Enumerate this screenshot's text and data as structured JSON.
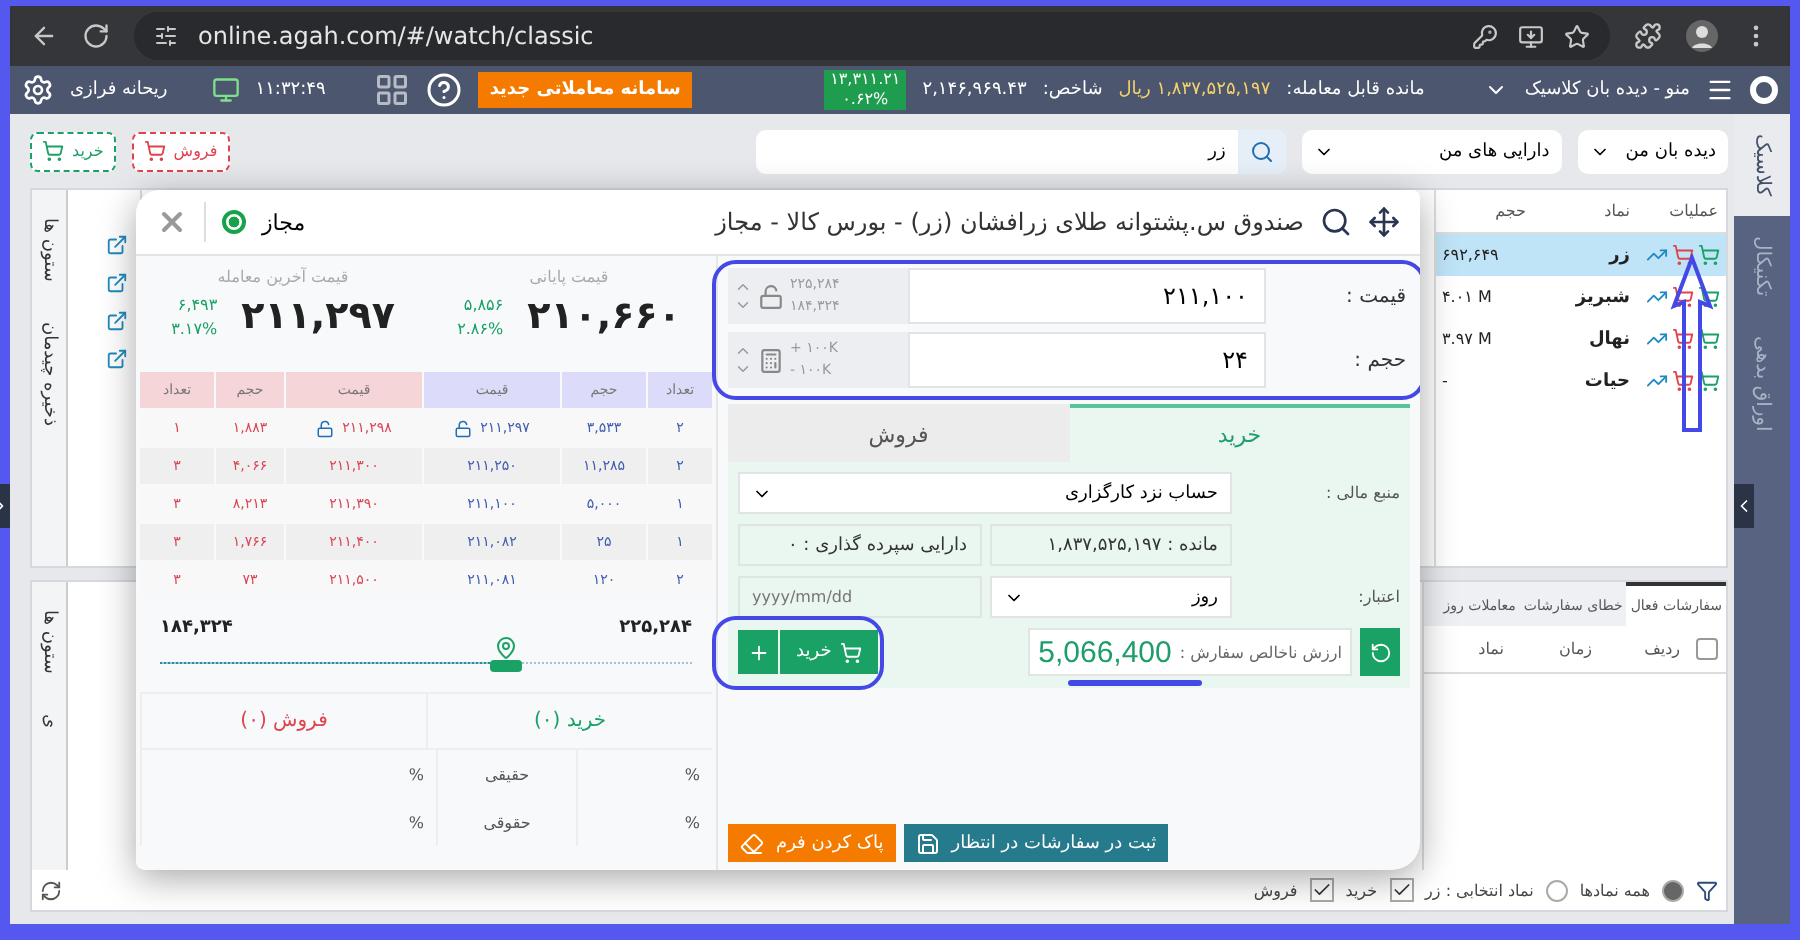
{
  "browser": {
    "url": "online.agah.com/#/watch/classic"
  },
  "header": {
    "menu": "منو - دیده بان کلاسیک",
    "balance_label": "مانده قابل معامله:",
    "balance": "۱,۸۳۷,۵۲۵,۱۹۷ ریال",
    "index_label": "شاخص:",
    "index": "۲,۱۴۶,۹۶۹.۴۳",
    "index_change": "۱۳,۳۱۱.۲۱",
    "index_percent": "۰.۶۲%",
    "new_system": "سامانه معاملاتی جدید",
    "time": "۱۱:۳۲:۴۹",
    "user": "ریحانه فرازی"
  },
  "toolbar": {
    "watchlist": "دیده بان من",
    "assets": "دارایی های من",
    "search": "زر",
    "sell": "فروش",
    "buy": "خرید"
  },
  "side_tabs": [
    {
      "label": "کلاسیک",
      "selected": true
    },
    {
      "label": "تکنیکال",
      "selected": false
    },
    {
      "label": "اوراق بدهی",
      "selected": false
    }
  ],
  "left_panel": {
    "top_labels": [
      "ستون ها",
      "ذخیره چیدمان"
    ],
    "bottom_labels": [
      "ستون ها",
      "ی"
    ]
  },
  "watchlist": {
    "columns": [
      "عملیات",
      "نماد",
      "حجم"
    ],
    "rows": [
      {
        "symbol": "زر",
        "volume": "۶۹۲,۶۴۹",
        "selected": true
      },
      {
        "symbol": "شبریز",
        "volume": "۴.۰۱ M",
        "selected": false
      },
      {
        "symbol": "نهال",
        "volume": "۳.۹۷ M",
        "selected": false
      },
      {
        "symbol": "حیات",
        "volume": "-",
        "selected": false
      }
    ]
  },
  "orders": {
    "tabs": [
      {
        "label": "سفارشات فعال",
        "selected": true
      },
      {
        "label": "خطای سفارشات",
        "selected": false
      },
      {
        "label": "معاملات روز",
        "selected": false
      }
    ],
    "select_all": {
      "checked": false
    },
    "columns": [
      "ردیف",
      "زمان",
      "نماد"
    ],
    "filters": [
      {
        "kind": "radio",
        "label": "همه نمادها",
        "checked": true
      },
      {
        "kind": "radio",
        "label": "نماد انتخابی : زر",
        "checked": false
      },
      {
        "kind": "checkbox",
        "label": "خرید",
        "checked": true
      },
      {
        "kind": "checkbox",
        "label": "فروش",
        "checked": true
      }
    ]
  },
  "dialog": {
    "title": "صندوق س.پشتوانه طلای زرافشان (زر) - بورس کالا - مجاز",
    "status": {
      "label": "مجاز",
      "on": true
    },
    "close_price": {
      "label": "قیمت پایانی",
      "value": "۲۱۰,۶۶۰",
      "change": "۵,۸۵۶",
      "percent": "۲.۸۶%"
    },
    "last_price": {
      "label": "قیمت آخرین معامله",
      "value": "۲۱۱,۲۹۷",
      "change": "۶,۴۹۳",
      "percent": "۳.۱۷%"
    },
    "order_book": {
      "buy_columns": [
        "تعداد",
        "حجم",
        "قیمت"
      ],
      "sell_columns": [
        "قیمت",
        "حجم",
        "تعداد"
      ],
      "rows": [
        {
          "buy_count": "۲",
          "buy_volume": "۳,۵۳۳",
          "buy_price": "۲۱۱,۲۹۷",
          "buy_locked": true,
          "sell_price": "۲۱۱,۲۹۸",
          "sell_locked": true,
          "sell_volume": "۱,۸۸۳",
          "sell_count": "۱"
        },
        {
          "buy_count": "۲",
          "buy_volume": "۱۱,۲۸۵",
          "buy_price": "۲۱۱,۲۵۰",
          "buy_locked": false,
          "sell_price": "۲۱۱,۳۰۰",
          "sell_locked": false,
          "sell_volume": "۴,۰۶۶",
          "sell_count": "۳"
        },
        {
          "buy_count": "۱",
          "buy_volume": "۵,۰۰۰",
          "buy_price": "۲۱۱,۱۰۰",
          "buy_locked": false,
          "sell_price": "۲۱۱,۳۹۰",
          "sell_locked": false,
          "sell_volume": "۸,۲۱۳",
          "sell_count": "۳"
        },
        {
          "buy_count": "۱",
          "buy_volume": "۲۵",
          "buy_price": "۲۱۱,۰۸۲",
          "buy_locked": false,
          "sell_price": "۲۱۱,۴۰۰",
          "sell_locked": false,
          "sell_volume": "۱,۷۶۶",
          "sell_count": "۳"
        },
        {
          "buy_count": "۲",
          "buy_volume": "۱۲۰",
          "buy_price": "۲۱۱,۰۸۱",
          "buy_locked": false,
          "sell_price": "۲۱۱,۵۰۰",
          "sell_locked": false,
          "sell_volume": "۷۳",
          "sell_count": "۳"
        }
      ]
    },
    "range": {
      "min": "۱۸۴,۳۲۴",
      "max": "۲۲۵,۲۸۴",
      "level": 0.65
    },
    "participants": {
      "buy_total": "خرید (۰)",
      "sell_total": "فروش (۰)",
      "rows": [
        {
          "label": "حقیقی",
          "buy": "%",
          "sell": "%"
        },
        {
          "label": "حقوقی",
          "buy": "%",
          "sell": "%"
        }
      ]
    },
    "form": {
      "price_label": "قیمت :",
      "price": "۲۱۱,۱۰۰",
      "price_max": "۲۲۵,۲۸۴",
      "price_min": "۱۸۴,۳۲۴",
      "volume_label": "حجم :",
      "volume": "۲۴",
      "volume_up": "+ ۱۰۰K",
      "volume_down": "- ۱۰۰K",
      "tabs": [
        {
          "label": "خرید",
          "selected": true
        },
        {
          "label": "فروش",
          "selected": false
        }
      ],
      "source_label": "منبع مالی :",
      "source": "حساب نزد کارگزاری",
      "balance": "مانده : ۱,۸۳۷,۵۲۵,۱۹۷",
      "deposit": "دارایی سپرده گذاری : ۰",
      "validity_label": "اعتبار:",
      "validity": "روز",
      "date_placeholder": "yyyy/mm/dd",
      "gross_label": "ارزش ناخالص سفارش :",
      "gross_value": "5,066,400",
      "submit": "خرید",
      "save_pending": "ثبت در سفارشات در انتظار",
      "clear": "پاک کردن فرم"
    }
  }
}
